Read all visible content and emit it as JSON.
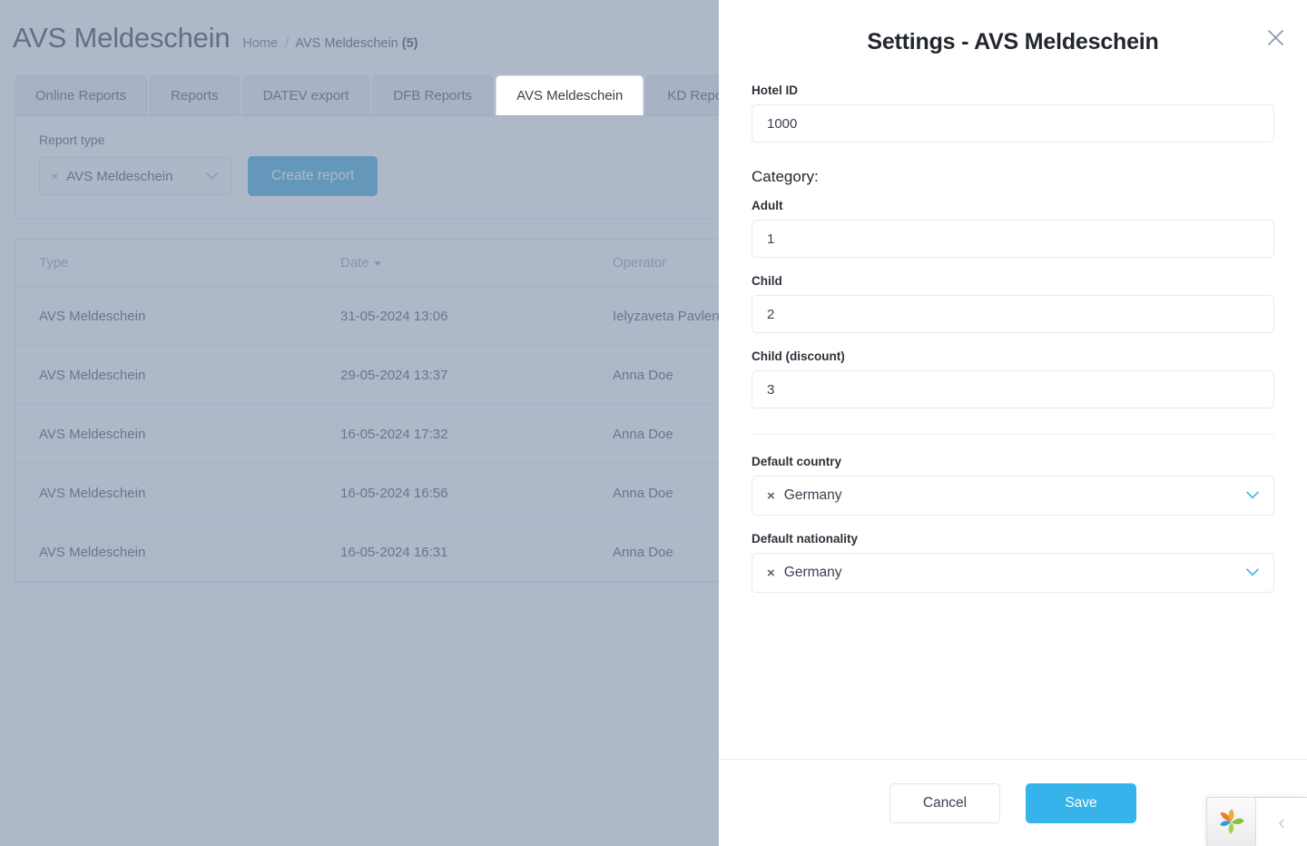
{
  "background": {
    "page_title": "AVS Meldeschein",
    "breadcrumb": {
      "home": "Home",
      "separator": "/",
      "current": "AVS Meldeschein",
      "count": "(5)"
    },
    "tabs": [
      {
        "label": "Online Reports",
        "active": false
      },
      {
        "label": "Reports",
        "active": false
      },
      {
        "label": "DATEV export",
        "active": false
      },
      {
        "label": "DFB Reports",
        "active": false
      },
      {
        "label": "AVS Meldeschein",
        "active": true
      },
      {
        "label": "KD Reports",
        "active": false
      }
    ],
    "filter": {
      "report_type_label": "Report type",
      "report_type_value": "AVS Meldeschein",
      "clear_icon": "×",
      "chevron_icon": "⌄",
      "create_report_label": "Create report"
    },
    "table": {
      "columns": [
        "Type",
        "Date",
        "Operator"
      ],
      "sorted_column": "Date",
      "rows": [
        {
          "type": "AVS Meldeschein",
          "date": "31-05-2024 13:06",
          "operator": "Ielyzaveta Pavlenko"
        },
        {
          "type": "AVS Meldeschein",
          "date": "29-05-2024 13:37",
          "operator": "Anna Doe"
        },
        {
          "type": "AVS Meldeschein",
          "date": "16-05-2024 17:32",
          "operator": "Anna Doe"
        },
        {
          "type": "AVS Meldeschein",
          "date": "16-05-2024 16:56",
          "operator": "Anna Doe"
        },
        {
          "type": "AVS Meldeschein",
          "date": "16-05-2024 16:31",
          "operator": "Anna Doe"
        }
      ]
    }
  },
  "panel": {
    "title": "Settings - AVS Meldeschein",
    "close_icon": "close-icon",
    "hotel_id": {
      "label": "Hotel ID",
      "value": "1000",
      "placeholder": "Hotel ID"
    },
    "category": {
      "section_label": "Category:",
      "fields": [
        {
          "label": "Adult",
          "value": "1",
          "placeholder": "Adult"
        },
        {
          "label": "Child",
          "value": "2",
          "placeholder": "Child"
        },
        {
          "label": "Child (discount)",
          "value": "3",
          "placeholder": "Child (discount)"
        }
      ]
    },
    "defaults": [
      {
        "label": "Default country",
        "value": "Germany",
        "clear_icon": "×"
      },
      {
        "label": "Default nationality",
        "value": "Germany",
        "clear_icon": "×"
      }
    ],
    "footer": {
      "cancel_label": "Cancel",
      "save_label": "Save"
    }
  },
  "chat_widget": {
    "logo_name": "pinwheel-logo",
    "collapse_icon": "‹",
    "colors": {
      "petal_orange": "#ef7d2e",
      "petal_green": "#86c440",
      "petal_blue": "#2e9fd8"
    }
  },
  "colors": {
    "accent_blue": "#35b3ea",
    "create_button": "#3fa8db",
    "overlay": "#7d8da7",
    "text_dark": "#22262e"
  }
}
